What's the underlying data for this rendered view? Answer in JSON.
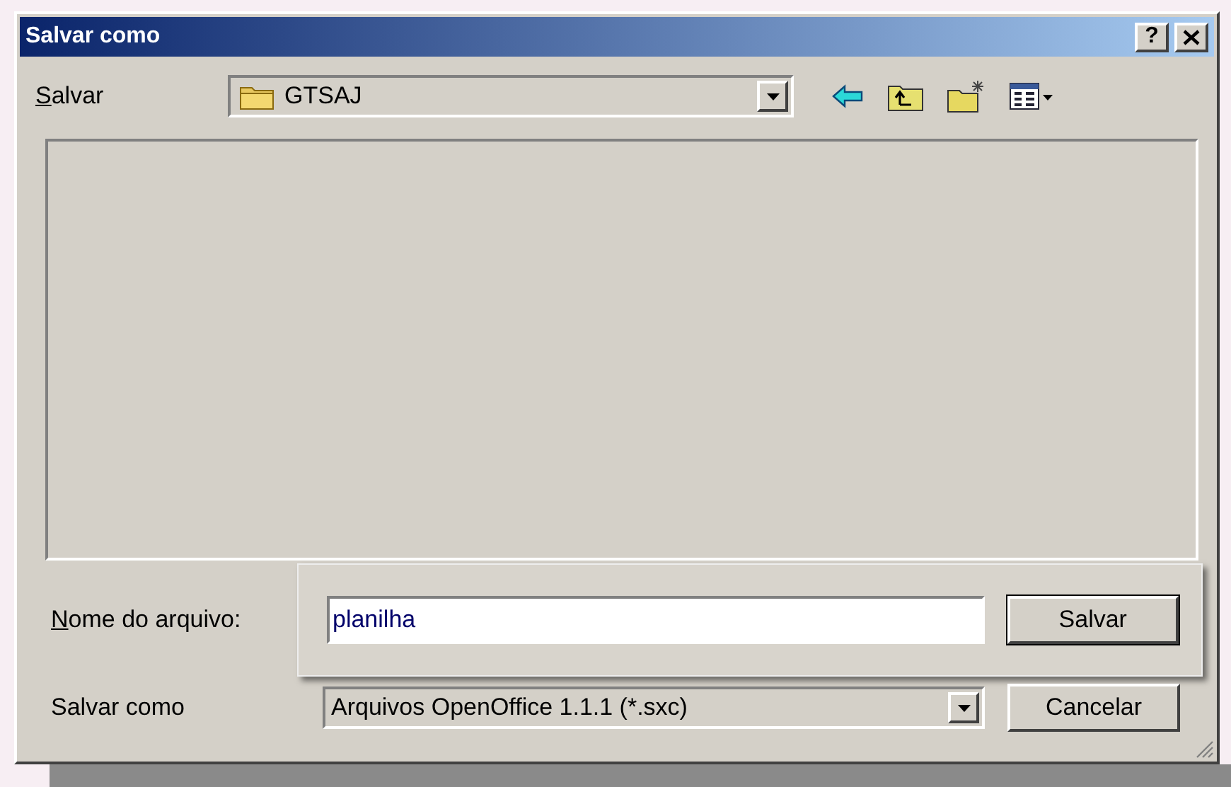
{
  "window": {
    "title": "Salvar como",
    "help": "?"
  },
  "save_in": {
    "label": "Salvar",
    "value": "GTSAJ"
  },
  "file_name": {
    "label": "Nome do arquivo:",
    "value": "planilha"
  },
  "file_type": {
    "label": "Salvar como",
    "value": "Arquivos OpenOffice 1.1.1 (*.sxc)"
  },
  "buttons": [
    {
      "label": "Salvar",
      "kind": "default"
    },
    {
      "label": "Cancelar",
      "kind": "normal"
    }
  ]
}
